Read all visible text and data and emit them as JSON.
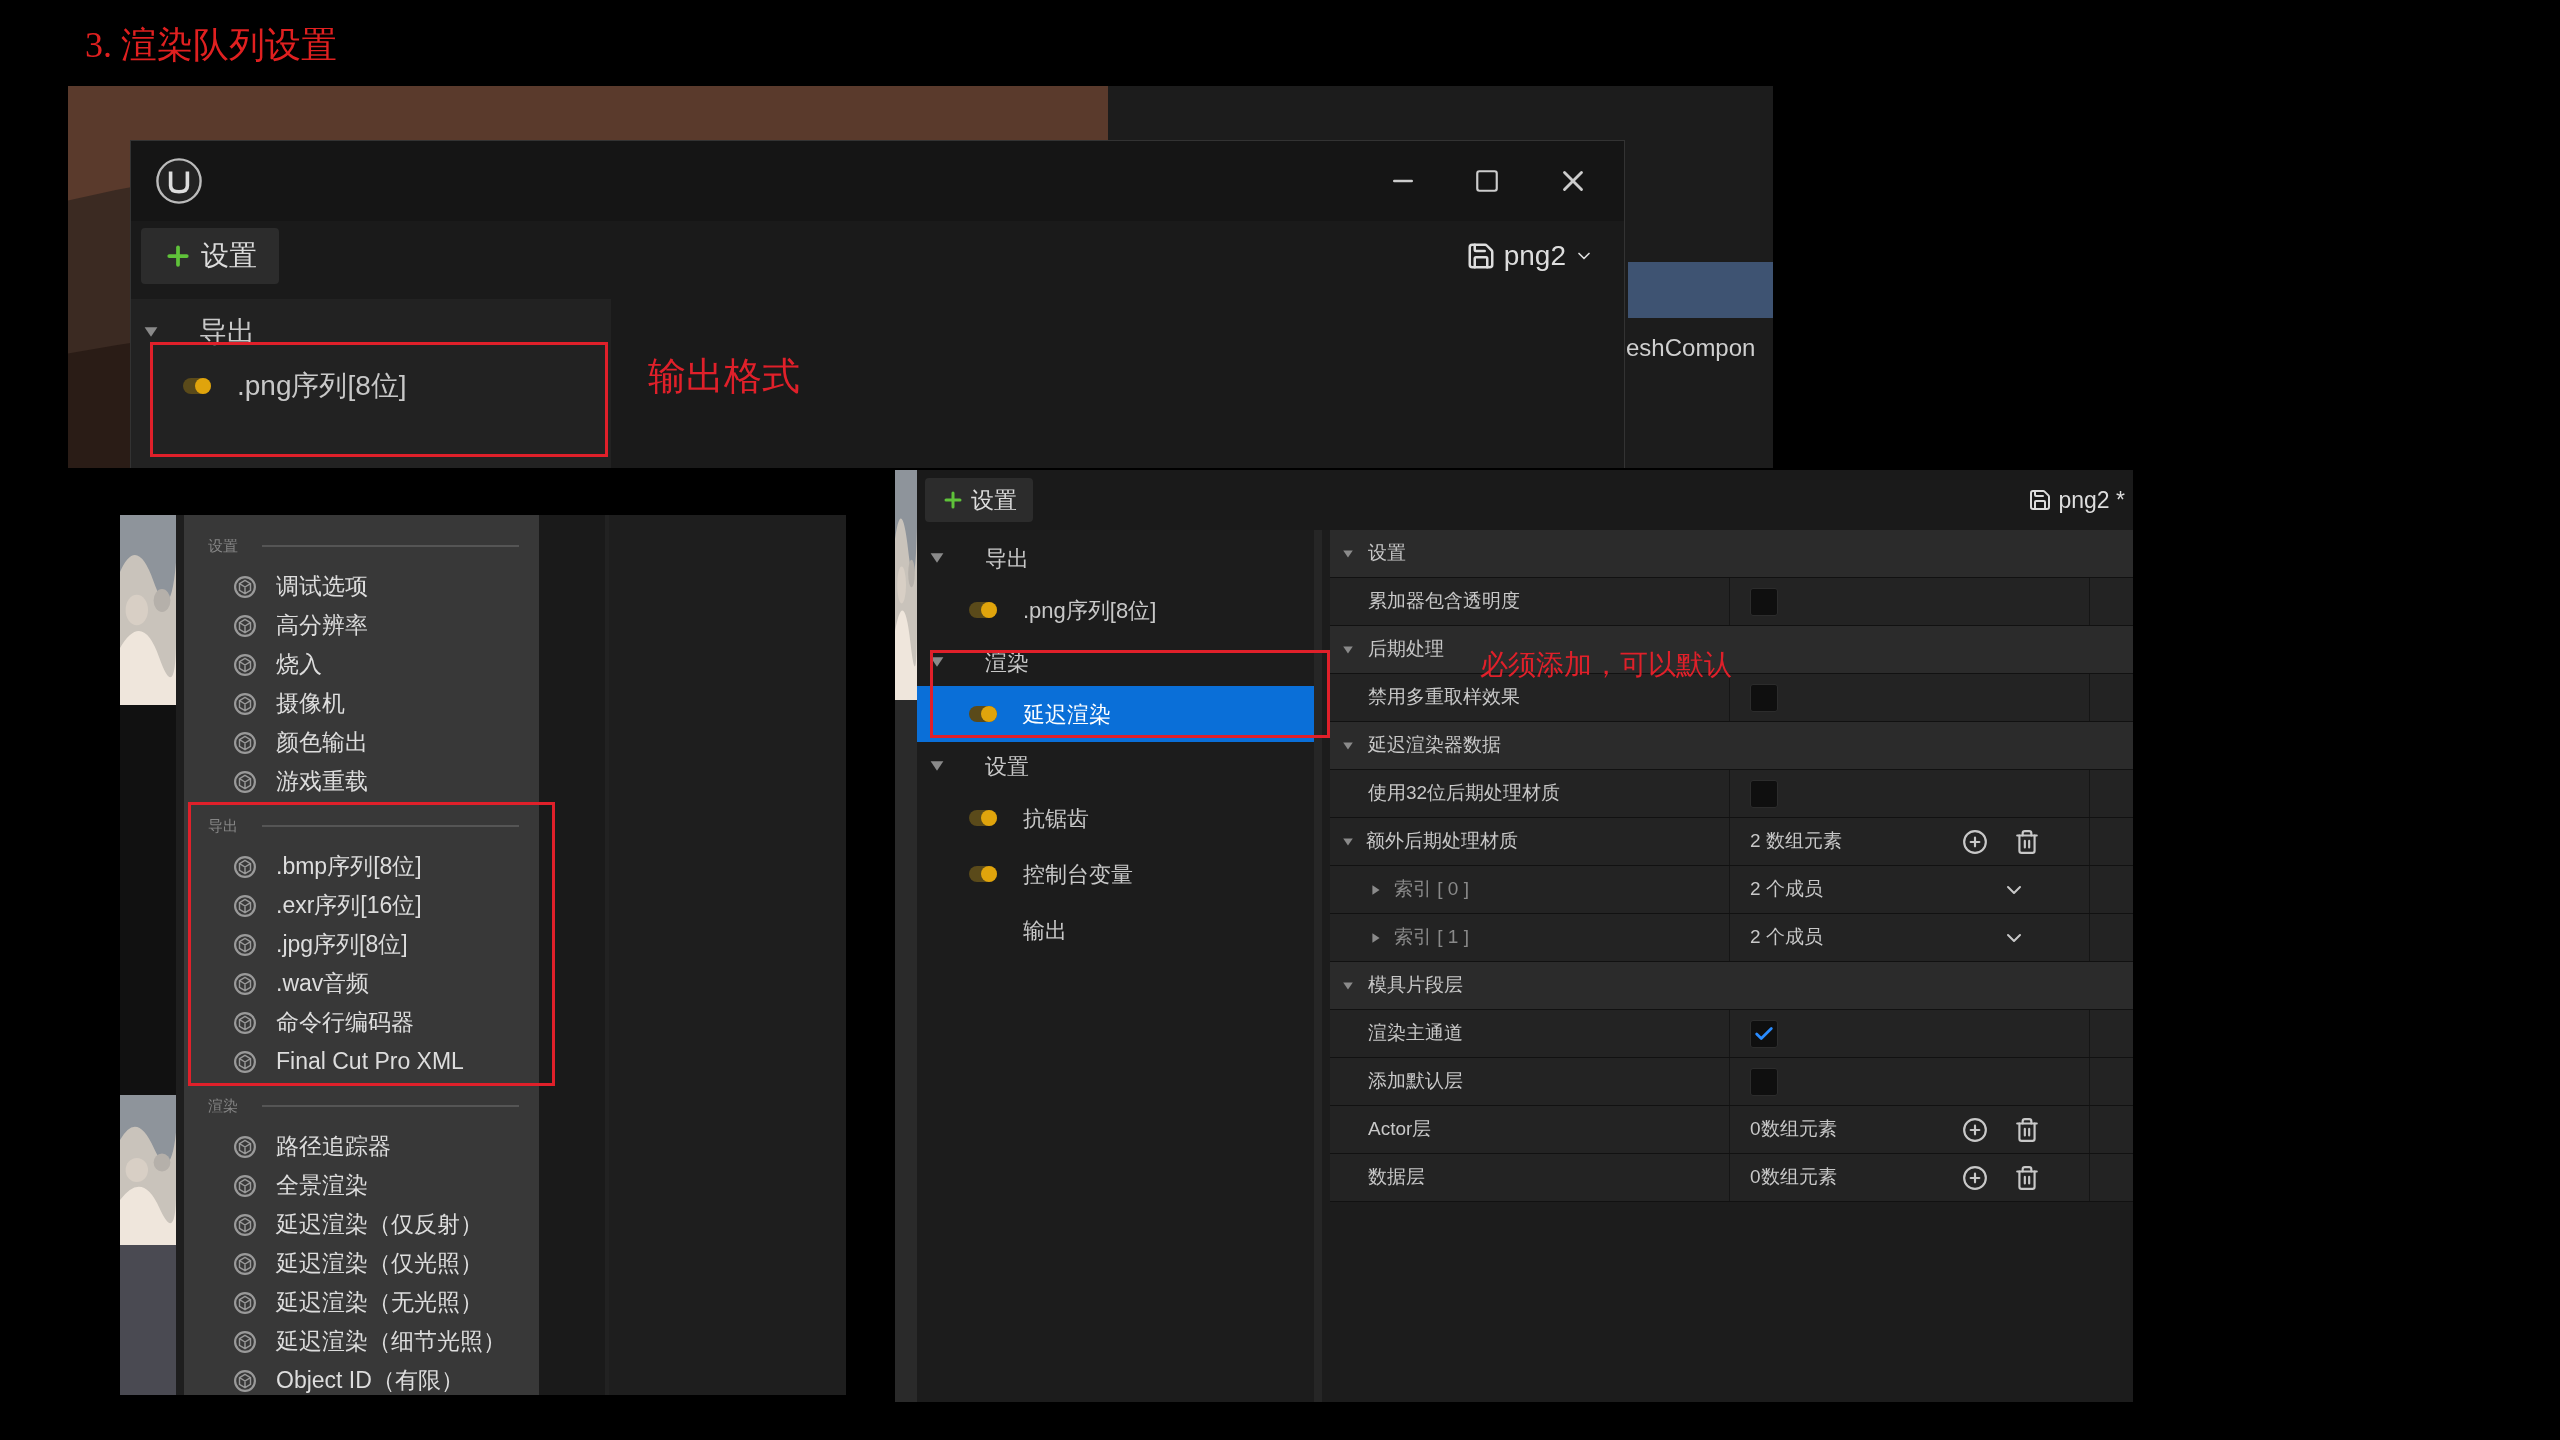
{
  "slide_title": "3. 渲染队列设置",
  "top_window": {
    "add_button": "设置",
    "preset": "png2",
    "behind_label": "eshCompon",
    "annotation": "输出格式",
    "tree": [
      {
        "label": "导出",
        "expanded": true,
        "children": [
          {
            "label": ".png序列[8位]",
            "kind": "toggle",
            "enabled": true,
            "selected": false
          }
        ]
      }
    ]
  },
  "menu": {
    "sections": [
      {
        "label": "设置",
        "items": [
          "调试选项",
          "高分辨率",
          "烧入",
          "摄像机",
          "颜色输出",
          "游戏重载"
        ]
      },
      {
        "label": "导出",
        "items": [
          ".bmp序列[8位]",
          ".exr序列[16位]",
          ".jpg序列[8位]",
          ".wav音频",
          "命令行编码器",
          "Final Cut Pro XML"
        ]
      },
      {
        "label": "渲染",
        "items": [
          "路径追踪器",
          "全景渲染",
          "延迟渲染（仅反射）",
          "延迟渲染（仅光照）",
          "延迟渲染（无光照）",
          "延迟渲染（细节光照）",
          "Object ID（有限）"
        ]
      }
    ]
  },
  "main_window": {
    "add_button": "设置",
    "preset": "png2 *",
    "annotation": "必须添加，可以默认",
    "tree": [
      {
        "label": "导出",
        "expanded": true,
        "children": [
          {
            "label": ".png序列[8位]",
            "kind": "toggle",
            "enabled": true,
            "selected": false
          }
        ]
      },
      {
        "label": "渲染",
        "expanded": true,
        "children": [
          {
            "label": "延迟渲染",
            "kind": "toggle",
            "enabled": true,
            "selected": true
          }
        ]
      },
      {
        "label": "设置",
        "expanded": true,
        "children": [
          {
            "label": "抗锯齿",
            "kind": "toggle",
            "enabled": true,
            "selected": false
          },
          {
            "label": "控制台变量",
            "kind": "toggle",
            "enabled": true,
            "selected": false
          },
          {
            "label": "输出",
            "kind": "plain",
            "selected": false
          }
        ]
      }
    ],
    "details": [
      {
        "label": "设置",
        "expanded": true,
        "rows": [
          {
            "label": "累加器包含透明度",
            "kind": "checkbox",
            "checked": false
          }
        ]
      },
      {
        "label": "后期处理",
        "expanded": true,
        "rows": [
          {
            "label": "禁用多重取样效果",
            "kind": "checkbox",
            "checked": false
          }
        ]
      },
      {
        "label": "延迟渲染器数据",
        "expanded": true,
        "rows": [
          {
            "label": "使用32位后期处理材质",
            "kind": "checkbox",
            "checked": false
          },
          {
            "label": "额外后期处理材质",
            "kind": "array",
            "value": "2 数组元素",
            "expanded": true,
            "children": [
              {
                "label": "索引 [ 0 ]",
                "kind": "member",
                "value": "2 个成员",
                "expanded": false
              },
              {
                "label": "索引 [ 1 ]",
                "kind": "member",
                "value": "2 个成员",
                "expanded": false
              }
            ]
          }
        ]
      },
      {
        "label": "模具片段层",
        "expanded": true,
        "rows": [
          {
            "label": "渲染主通道",
            "kind": "checkbox",
            "checked": true
          },
          {
            "label": "添加默认层",
            "kind": "checkbox",
            "checked": false
          },
          {
            "label": "Actor层",
            "kind": "array",
            "value": "0数组元素"
          },
          {
            "label": "数据层",
            "kind": "array",
            "value": "0数组元素"
          }
        ]
      }
    ]
  }
}
